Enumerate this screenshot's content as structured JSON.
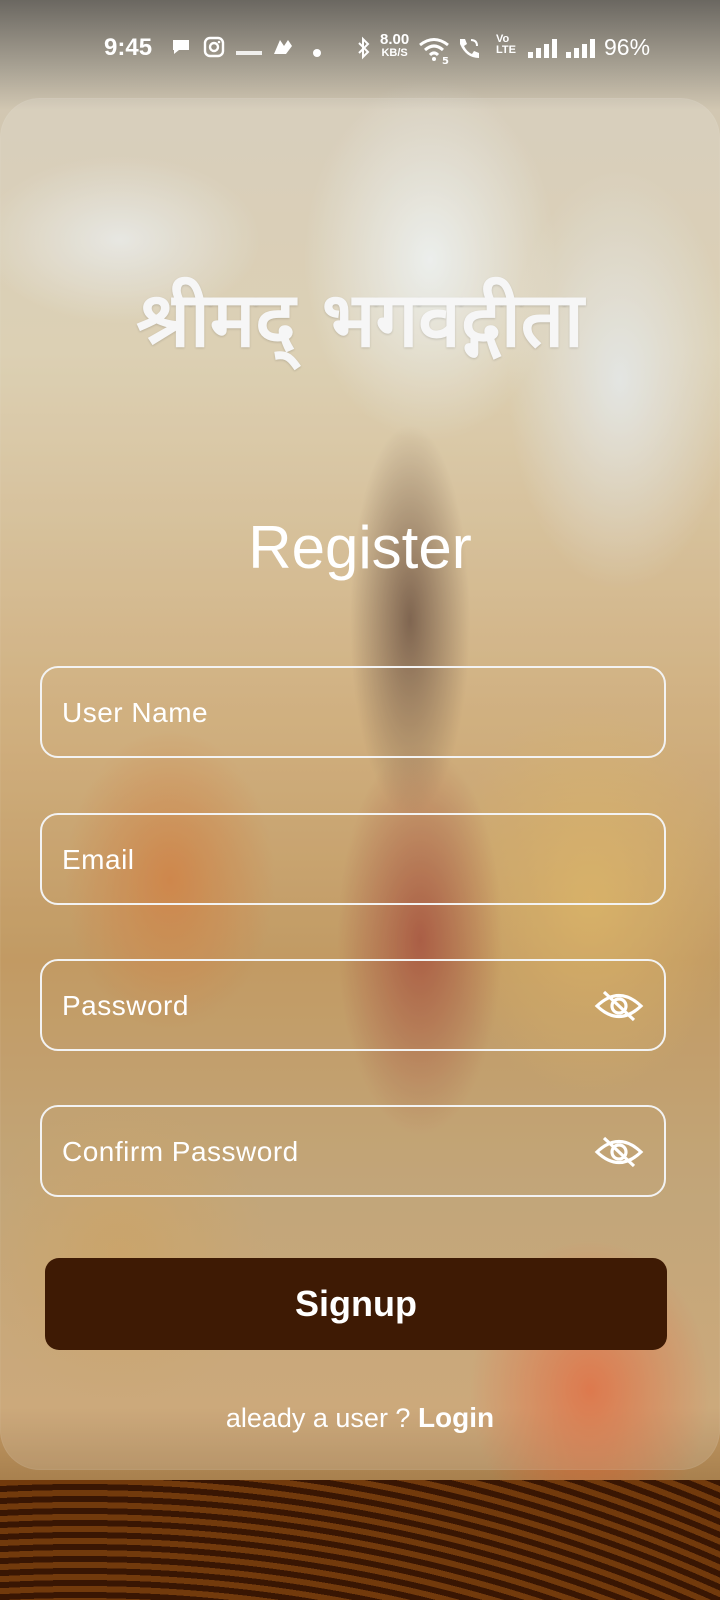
{
  "status_bar": {
    "time": "9:45",
    "notification_icons": [
      "chat-bubble-icon",
      "instagram-icon",
      "univest-icon",
      "app-icon",
      "dot-icon"
    ],
    "network_speed_value": "8.00",
    "network_speed_unit": "KB/S",
    "volte_top": "Vo",
    "volte_bottom": "LTE",
    "wifi_sub": "5",
    "battery": "96%"
  },
  "app": {
    "title": "श्रीमद् भगवद्गीता"
  },
  "form": {
    "heading": "Register",
    "username_placeholder": "User Name",
    "email_placeholder": "Email",
    "password_placeholder": "Password",
    "confirm_password_placeholder": "Confirm Password",
    "password_toggle_icon": "eye-off-icon",
    "signup_label": "Signup",
    "already_user_text": "aleady a user ? ",
    "login_link": "Login"
  },
  "colors": {
    "signup_button": "#3e1a04",
    "field_border": "#f3f3f3",
    "text": "#ffffff"
  }
}
